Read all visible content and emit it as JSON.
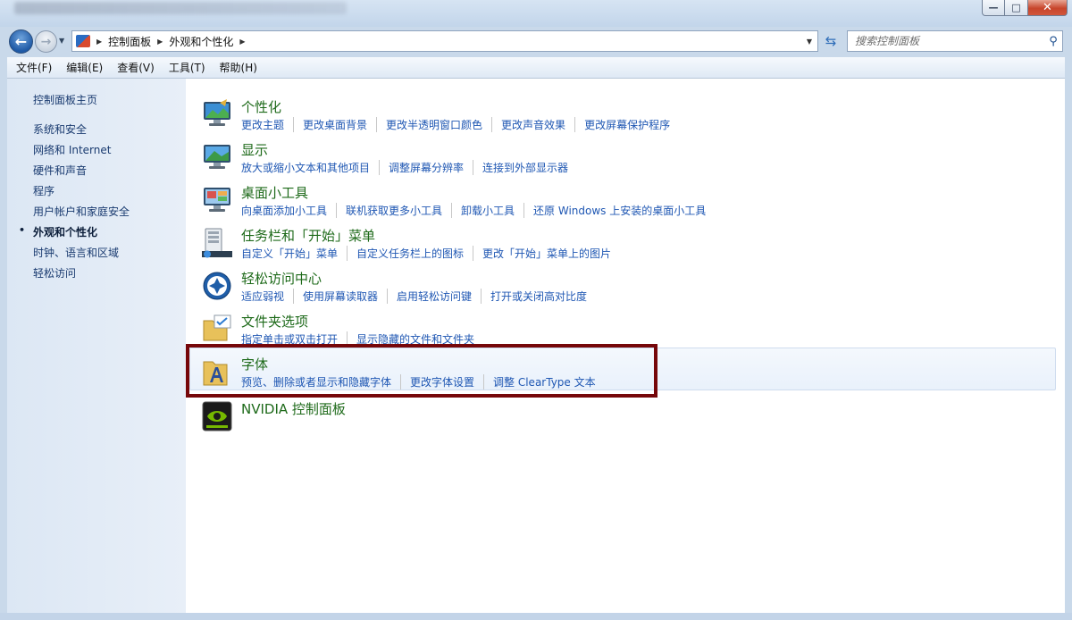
{
  "window": {
    "controls": {
      "minimize": "—",
      "maximize": "□",
      "close": "✕"
    }
  },
  "nav": {
    "back_icon": "back-arrow-icon",
    "forward_icon": "forward-arrow-icon",
    "address": {
      "crumbs": [
        "控制面板",
        "外观和个性化"
      ]
    },
    "search": {
      "placeholder": "搜索控制面板"
    }
  },
  "menu": {
    "items": [
      "文件(F)",
      "编辑(E)",
      "查看(V)",
      "工具(T)",
      "帮助(H)"
    ]
  },
  "sidebar": {
    "home": "控制面板主页",
    "items": [
      "系统和安全",
      "网络和 Internet",
      "硬件和声音",
      "程序",
      "用户帐户和家庭安全",
      "外观和个性化",
      "时钟、语言和区域",
      "轻松访问"
    ],
    "current_index": 5
  },
  "categories": [
    {
      "title": "个性化",
      "icon": "personalization-monitor-icon",
      "links": [
        "更改主题",
        "更改桌面背景",
        "更改半透明窗口颜色",
        "更改声音效果",
        "更改屏幕保护程序"
      ]
    },
    {
      "title": "显示",
      "icon": "display-monitor-icon",
      "links": [
        "放大或缩小文本和其他项目",
        "调整屏幕分辨率",
        "连接到外部显示器"
      ]
    },
    {
      "title": "桌面小工具",
      "icon": "desktop-gadgets-icon",
      "links": [
        "向桌面添加小工具",
        "联机获取更多小工具",
        "卸载小工具",
        "还原 Windows 上安装的桌面小工具"
      ]
    },
    {
      "title": "任务栏和「开始」菜单",
      "icon": "taskbar-start-menu-icon",
      "links": [
        "自定义「开始」菜单",
        "自定义任务栏上的图标",
        "更改「开始」菜单上的图片"
      ]
    },
    {
      "title": "轻松访问中心",
      "icon": "ease-of-access-icon",
      "links": [
        "适应弱视",
        "使用屏幕读取器",
        "启用轻松访问键",
        "打开或关闭高对比度"
      ]
    },
    {
      "title": "文件夹选项",
      "icon": "folder-options-icon",
      "links": [
        "指定单击或双击打开",
        "显示隐藏的文件和文件夹"
      ]
    },
    {
      "title": "字体",
      "icon": "fonts-folder-icon",
      "links": [
        "预览、删除或者显示和隐藏字体",
        "更改字体设置",
        "调整 ClearType 文本"
      ]
    },
    {
      "title": "NVIDIA 控制面板",
      "icon": "nvidia-icon",
      "links": []
    }
  ],
  "colors": {
    "title_green": "#1e6a1a",
    "link_blue": "#1f57b3",
    "highlight_box": "#76070a"
  }
}
